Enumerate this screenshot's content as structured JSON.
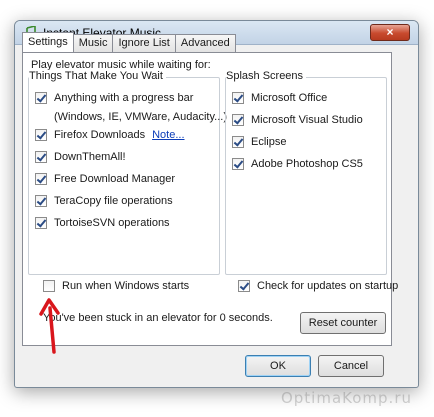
{
  "window": {
    "title": "Instant Elevator Music",
    "close_label": "×"
  },
  "tabs": [
    {
      "label": "Settings",
      "active": true
    },
    {
      "label": "Music",
      "active": false
    },
    {
      "label": "Ignore List",
      "active": false
    },
    {
      "label": "Advanced",
      "active": false
    }
  ],
  "settings": {
    "play_label": "Play elevator music while waiting for:",
    "wait_group": {
      "label": "Things That Make You Wait",
      "items": [
        {
          "label": "Anything with a progress bar",
          "checked": true
        },
        {
          "label": "(Windows, IE, VMWare, Audacity...)",
          "checked": null
        },
        {
          "label": "Firefox Downloads",
          "checked": true,
          "link": "Note..."
        },
        {
          "label": "DownThemAll!",
          "checked": true
        },
        {
          "label": "Free Download Manager",
          "checked": true
        },
        {
          "label": "TeraCopy file operations",
          "checked": true
        },
        {
          "label": "TortoiseSVN operations",
          "checked": true
        }
      ]
    },
    "splash_group": {
      "label": "Splash Screens",
      "items": [
        {
          "label": "Microsoft Office",
          "checked": true
        },
        {
          "label": "Microsoft Visual Studio",
          "checked": true
        },
        {
          "label": "Eclipse",
          "checked": true
        },
        {
          "label": "Adobe Photoshop CS5",
          "checked": true
        }
      ]
    },
    "run_on_startup": {
      "label": "Run when Windows starts",
      "checked": false
    },
    "check_updates": {
      "label": "Check for updates on startup",
      "checked": true
    },
    "stuck_text": "You've been stuck in an elevator for 0 seconds.",
    "reset_label": "Reset counter"
  },
  "footer": {
    "ok_label": "OK",
    "cancel_label": "Cancel"
  },
  "watermark": "OptimaKomp.ru",
  "colors": {
    "accent_link": "#0b3cb8",
    "arrow": "#d9161c",
    "title_bar": "#c2d3e6"
  }
}
